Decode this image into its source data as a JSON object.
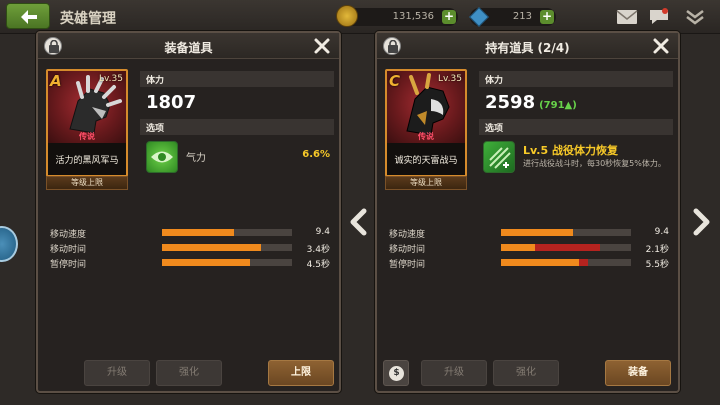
{
  "topbar": {
    "title": "英雄管理",
    "gold": "131,536",
    "gems": "213"
  },
  "left_panel": {
    "title": "装备道具",
    "item": {
      "grade": "A",
      "level": "Lv.35",
      "rarity": "传说",
      "name": "活力的黑风军马",
      "limit_tag": "等级上限"
    },
    "hp_label": "体力",
    "hp_value": "1807",
    "option_label": "选项",
    "option": {
      "name": "气力",
      "value": "6.6%"
    },
    "stats": [
      {
        "label": "移动速度",
        "value": "9.4",
        "fill": 0.55
      },
      {
        "label": "移动时间",
        "value": "3.4秒",
        "fill": 0.76
      },
      {
        "label": "暂停时间",
        "value": "4.5秒",
        "fill": 0.68
      }
    ],
    "buttons": {
      "upgrade": "升级",
      "enhance": "强化",
      "action": "上限"
    }
  },
  "right_panel": {
    "title": "持有道具 (2/4)",
    "item": {
      "grade": "C",
      "level": "Lv.35",
      "rarity": "传说",
      "name": "诚实的天雷战马",
      "limit_tag": "等级上限"
    },
    "hp_label": "体力",
    "hp_value": "2598",
    "hp_bonus": "(791▲)",
    "option_label": "选项",
    "option": {
      "title": "Lv.5 战役体力恢复",
      "desc": "进行战役战斗时，每30秒恢复5%体力。"
    },
    "stats": [
      {
        "label": "移动速度",
        "value": "9.4",
        "fill": 0.55,
        "red": 0
      },
      {
        "label": "移动时间",
        "value": "2.1秒",
        "fill": 0.26,
        "red": 0.5
      },
      {
        "label": "暂停时间",
        "value": "5.5秒",
        "fill": 0.6,
        "red": 0.07
      }
    ],
    "coin_glyph": "$",
    "buttons": {
      "upgrade": "升级",
      "enhance": "强化",
      "action": "装备"
    }
  },
  "icons": [
    "back-arrow-icon",
    "gold-coin-icon",
    "gem-icon",
    "mail-icon",
    "chat-icon",
    "collapse-icon",
    "lock-icon",
    "close-icon",
    "left-arrow-icon",
    "right-arrow-icon"
  ],
  "colors": {
    "accent_orange": "#f08a1d",
    "accent_red": "#b5231f",
    "option_yellow": "#f7c928",
    "bonus_green": "#67d24a"
  }
}
